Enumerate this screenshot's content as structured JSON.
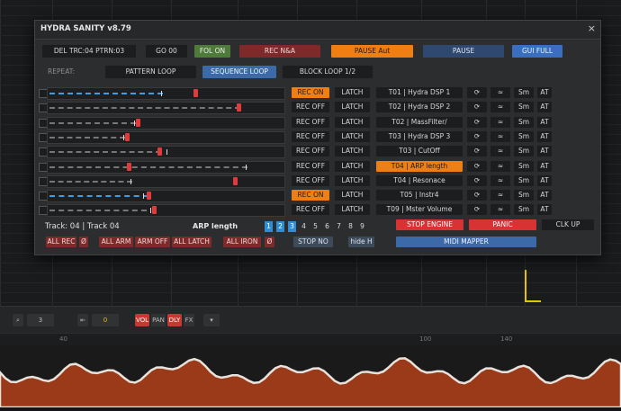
{
  "dialog": {
    "title": "HYDRA SANITY v8.79",
    "close_glyph": "×",
    "toolbar": {
      "del_label": "DEL TRC:04 PTRN:03",
      "go_label": "GO 00",
      "fol_label": "FOL ON",
      "rec_na_label": "REC N&A",
      "pause_aut_label": "PAUSE Aut",
      "pause_label": "PAUSE",
      "gui_full_label": "GUI FULL"
    },
    "repeat": {
      "label": "REPEAT:",
      "pattern_loop": "PATTERN LOOP",
      "sequence_loop": "SEQUENCE LOOP",
      "block_loop": "BLOCK LOOP 1/2"
    },
    "rows": [
      {
        "rec": "REC ON",
        "latch": "LATCH",
        "name": "T01 | Hydra DSP 1",
        "sm": "Sm",
        "at": "AT",
        "rec_on": true,
        "name_on": false,
        "active": true
      },
      {
        "rec": "REC OFF",
        "latch": "LATCH",
        "name": "T02 | Hydra  DSP 2",
        "sm": "Sm",
        "at": "AT",
        "rec_on": false,
        "name_on": false,
        "active": false
      },
      {
        "rec": "REC OFF",
        "latch": "LATCH",
        "name": "T02 | MassFilter/",
        "sm": "Sm",
        "at": "AT",
        "rec_on": false,
        "name_on": false,
        "active": false
      },
      {
        "rec": "REC OFF",
        "latch": "LATCH",
        "name": "T03 | Hydra DSP 3",
        "sm": "Sm",
        "at": "AT",
        "rec_on": false,
        "name_on": false,
        "active": false
      },
      {
        "rec": "REC OFF",
        "latch": "LATCH",
        "name": "T03 | CutOff",
        "sm": "Sm",
        "at": "AT",
        "rec_on": false,
        "name_on": false,
        "active": false
      },
      {
        "rec": "REC OFF",
        "latch": "LATCH",
        "name": "T04 | ARP length",
        "sm": "Sm",
        "at": "AT",
        "rec_on": false,
        "name_on": true,
        "active": false
      },
      {
        "rec": "REC OFF",
        "latch": "LATCH",
        "name": "T04 | Resonace",
        "sm": "Sm",
        "at": "AT",
        "rec_on": false,
        "name_on": false,
        "active": false
      },
      {
        "rec": "REC ON",
        "latch": "LATCH",
        "name": "T05 | Instr4",
        "sm": "Sm",
        "at": "AT",
        "rec_on": true,
        "name_on": false,
        "active": true
      },
      {
        "rec": "REC OFF",
        "latch": "LATCH",
        "name": "T09 | Mster Volume",
        "sm": "Sm",
        "at": "AT",
        "rec_on": false,
        "name_on": false,
        "active": false
      }
    ],
    "row_icons": {
      "loop": "⟳",
      "approx": "≈"
    },
    "footer": {
      "track_info": "Track: 04 | Track 04",
      "param_name": "ARP length",
      "banks": [
        "1",
        "2",
        "3",
        "4",
        "5",
        "6",
        "7",
        "8",
        "9"
      ],
      "banks_on": [
        1,
        2,
        3
      ],
      "stop_engine": "STOP ENGINE",
      "panic": "PANIC",
      "clk_up": "CLK UP",
      "midi_mapper": "MIDI MAPPER",
      "all_rec": "ALL REC",
      "zero": "Ø",
      "all_arm": "ALL ARM",
      "arm_off": "ARM OFF",
      "all_latch": "ALL LATCH",
      "all_iron": "ALL IRON",
      "stop_no": "STOP NO",
      "hide_h": "hide H"
    }
  },
  "lower_toolbar": {
    "octave_value": "3",
    "step_value": "0",
    "vol": "VOL",
    "pan": "PAN",
    "dly": "DLY",
    "fx": "FX"
  },
  "ruler_marks": [
    "40",
    "100",
    "140"
  ],
  "colors": {
    "rec_on": "#ef7f12",
    "accent_blue": "#3a6fc0",
    "waveform": "#9a3a18"
  }
}
